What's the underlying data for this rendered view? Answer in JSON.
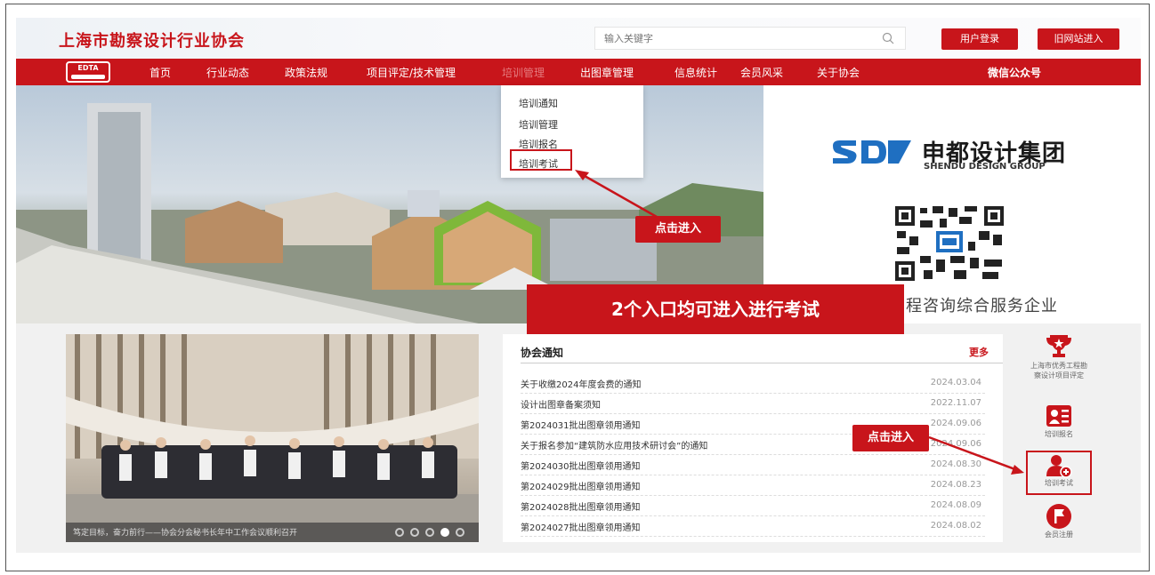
{
  "header": {
    "site_title": "上海市勘察设计行业协会",
    "search_placeholder": "输入关键字",
    "login_label": "用户登录",
    "old_site_label": "旧网站进入"
  },
  "nav": {
    "logo_text": "EDTA",
    "items": [
      "首页",
      "行业动态",
      "政策法规",
      "项目评定/技术管理",
      "培训管理",
      "出图章管理",
      "信息统计",
      "会员风采",
      "关于协会",
      "微信公众号"
    ]
  },
  "dropdown": {
    "items": [
      "培训通知",
      "培训管理",
      "培训报名",
      "培训考试"
    ]
  },
  "ad": {
    "company_cn": "申都设计集团",
    "company_en": "SHENDU DESIGN GROUP",
    "slogan": "程咨询综合服务企业"
  },
  "callouts": {
    "banner": "2个入口均可进入进行考试",
    "click_enter_1": "点击进入",
    "click_enter_2": "点击进入"
  },
  "photo": {
    "caption": "笃定目标，奋力前行——协会分会秘书长年中工作会议顺利召开",
    "slide_count": 5,
    "active_slide": 4
  },
  "notice": {
    "title": "协会通知",
    "more_label": "更多",
    "rows": [
      {
        "text": "关于收缴2024年度会费的通知",
        "date": "2024.03.04"
      },
      {
        "text": "设计出图章备案须知",
        "date": "2022.11.07"
      },
      {
        "text": "第2024031批出图章领用通知",
        "date": "2024.09.06"
      },
      {
        "text": "关于报名参加“建筑防水应用技术研讨会”的通知",
        "date": "2024.09.06"
      },
      {
        "text": "第2024030批出图章领用通知",
        "date": "2024.08.30"
      },
      {
        "text": "第2024029批出图章领用通知",
        "date": "2024.08.23"
      },
      {
        "text": "第2024028批出图章领用通知",
        "date": "2024.08.09"
      },
      {
        "text": "第2024027批出图章领用通知",
        "date": "2024.08.02"
      }
    ]
  },
  "side": {
    "award_label": "上海市优秀工程勘察设计项目评定",
    "signup_label": "培训报名",
    "exam_label": "培训考试",
    "register_label": "会员注册"
  },
  "colors": {
    "brand_red": "#c8151b",
    "ad_blue": "#1f6fc1"
  }
}
